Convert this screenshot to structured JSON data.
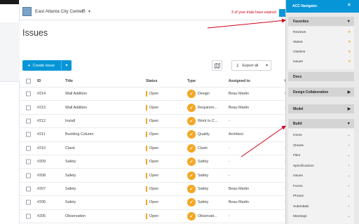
{
  "header": {
    "project_name": "East Atlanta City Center",
    "trial_text": "3 of your trials have expired"
  },
  "page": {
    "title": "Issues"
  },
  "toolbar": {
    "create_label": "Create Issue",
    "export_label": "Export all"
  },
  "table": {
    "columns": [
      "ID",
      "Title",
      "Status",
      "Type",
      "Assigned to",
      "D"
    ],
    "rows": [
      {
        "id": "#214",
        "title": "Wall Addition",
        "status": "Open",
        "type": "Design",
        "assigned": "Beau Martin",
        "due": "Se"
      },
      {
        "id": "#213",
        "title": "Wall Addition",
        "status": "Open",
        "type": "Requirem...",
        "assigned": "Beau Martin",
        "due": "-"
      },
      {
        "id": "#212",
        "title": "Install",
        "status": "Open",
        "type": "Work to C...",
        "assigned": "-",
        "due": "-"
      },
      {
        "id": "#211",
        "title": "Buckling Column",
        "status": "Open",
        "type": "Quality",
        "assigned": "Architect",
        "due": "-"
      },
      {
        "id": "#210",
        "title": "Clash",
        "status": "Open",
        "type": "Clash",
        "assigned": "-",
        "due": "-"
      },
      {
        "id": "#209",
        "title": "Safety",
        "status": "Open",
        "type": "Safety",
        "assigned": "-",
        "due": "-"
      },
      {
        "id": "#208",
        "title": "Safety",
        "status": "Open",
        "type": "Safety",
        "assigned": "-",
        "due": "-"
      },
      {
        "id": "#207",
        "title": "Safety",
        "status": "Open",
        "type": "Safety",
        "assigned": "Beau Martin",
        "due": "-"
      },
      {
        "id": "#206",
        "title": "Safety",
        "status": "Open",
        "type": "Safety",
        "assigned": "Beau Martin",
        "due": "-"
      },
      {
        "id": "#205",
        "title": "Observation",
        "status": "Open",
        "type": "Observati...",
        "assigned": "-",
        "due": "-"
      }
    ]
  },
  "navigator": {
    "title": "ACC Navigator",
    "close": "×",
    "favorites": {
      "label": "Favorites",
      "items": [
        "Reviews",
        "Status",
        "Clashes",
        "Issues"
      ]
    },
    "docs": {
      "label": "Docs"
    },
    "design_collab": {
      "label": "Design Collaboration"
    },
    "model": {
      "label": "Model"
    },
    "build": {
      "label": "Build",
      "items": [
        "Home",
        "Sheets",
        "Files",
        "Specifications",
        "Issues",
        "Forms",
        "Photos",
        "Submittals",
        "Meetings"
      ]
    }
  },
  "colors": {
    "accent": "#0696d7",
    "status_open": "#f5a623",
    "panel_bg": "#e8e8e8",
    "panel_section": "#d4d4d4",
    "arrow": "#d0021b"
  },
  "icons": {
    "gear": "gear-icon",
    "map": "map-icon",
    "export": "export-icon",
    "type_check": "checkmark-icon"
  }
}
